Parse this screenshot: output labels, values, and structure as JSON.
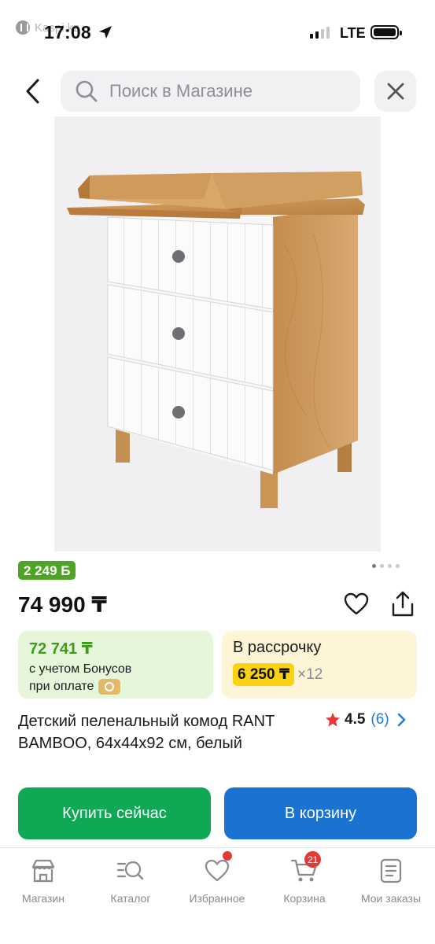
{
  "status_bar": {
    "back_app": "Kaspi.kz",
    "time": "17:08",
    "network": "LTE"
  },
  "search": {
    "placeholder": "Поиск в Магазине"
  },
  "product": {
    "image_alt": "Детский пеленальный комод",
    "bonus_badge": "2 249 Б",
    "image_pages": 4,
    "image_current": 1,
    "price": "74 990 ₸",
    "bonus_price": "72 741 ₸",
    "bonus_note_1": "с учетом Бонусов",
    "bonus_note_2": "при оплате",
    "installment_title": "В рассрочку",
    "installment_monthly": "6 250 ₸",
    "installment_months": "×12",
    "title": "Детский пеленальный комод RANT BAMBOO, 64х44х92 см, белый",
    "rating": "4.5",
    "reviews": "(6)"
  },
  "actions": {
    "buy_now": "Купить сейчас",
    "add_to_cart": "В корзину"
  },
  "tabs": [
    {
      "label": "Магазин",
      "icon": "store-icon"
    },
    {
      "label": "Каталог",
      "icon": "catalog-icon"
    },
    {
      "label": "Избранное",
      "icon": "heart-icon"
    },
    {
      "label": "Корзина",
      "icon": "cart-icon",
      "badge": "21"
    },
    {
      "label": "Мои заказы",
      "icon": "orders-icon"
    }
  ],
  "colors": {
    "buy": "#0fa855",
    "cart": "#1a73d0",
    "bonus": "#4fa326",
    "badge": "#e53935",
    "installment": "#f9d214"
  }
}
